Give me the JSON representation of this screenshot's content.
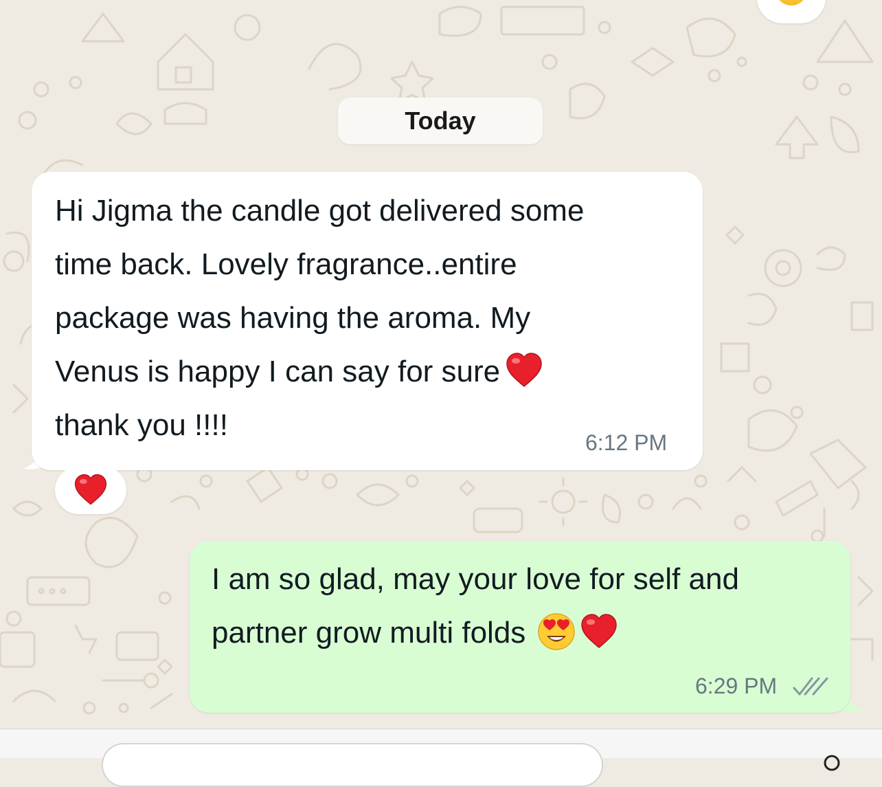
{
  "chat": {
    "date_divider": "Today",
    "messages": [
      {
        "direction": "incoming",
        "lines": [
          "Hi Jigma the candle got delivered some",
          "time back. Lovely fragrance..entire",
          "package was having the aroma. My",
          "Venus is happy I can say for sure",
          "thank you !!!!"
        ],
        "line_emojis": [
          "",
          "",
          "",
          "red-heart",
          ""
        ],
        "time": "6:12 PM",
        "reaction": "red-heart"
      },
      {
        "direction": "outgoing",
        "lines": [
          "I am so glad, may your love for self and",
          "partner grow multi folds"
        ],
        "trailing_emojis": [
          "heart-eyes",
          "red-heart"
        ],
        "time": "6:29 PM",
        "status": "read-double-check"
      }
    ],
    "top_reaction": "smiling-face"
  },
  "colors": {
    "background": "#EFEAE2",
    "incoming_bubble": "#FFFFFF",
    "outgoing_bubble": "#D9FDD3",
    "timestamp": "#667781",
    "tick": "#8696A0",
    "text": "#111B21"
  }
}
